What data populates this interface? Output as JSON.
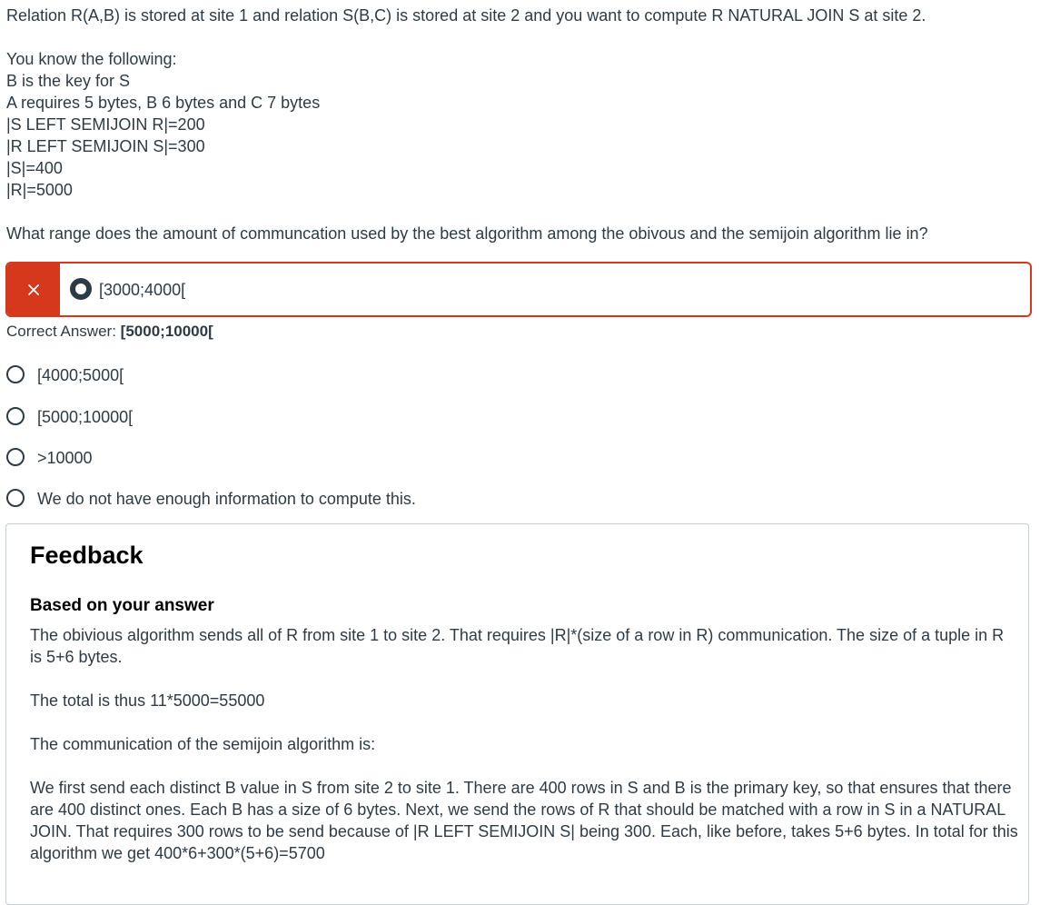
{
  "question": {
    "intro": "Relation R(A,B) is stored at site 1 and relation S(B,C) is stored at site 2 and you want to compute R NATURAL JOIN S at site 2.",
    "known_header": "You know the following:",
    "facts": [
      "B is the key for S",
      "A requires 5 bytes, B 6 bytes and C 7 bytes",
      "|S LEFT SEMIJOIN R|=200",
      "|R LEFT SEMIJOIN S|=300",
      "|S|=400",
      "|R|=5000"
    ],
    "prompt": "What range does the amount of communcation used by the best algorithm among the obivous and the semijoin algorithm lie in?"
  },
  "selected_answer": {
    "label": "[3000;4000[",
    "status": "incorrect",
    "marker_icon": "close-icon",
    "marker_color": "#d5381c"
  },
  "correct_answer": {
    "prefix": "Correct Answer:",
    "value": "[5000;10000["
  },
  "options": [
    {
      "label": "[4000;5000["
    },
    {
      "label": "[5000;10000["
    },
    {
      "label": ">10000"
    },
    {
      "label": "We do not have enough information to compute this."
    }
  ],
  "feedback": {
    "title": "Feedback",
    "subtitle": "Based on your answer",
    "paragraphs": [
      "The obivious algorithm sends all of R from site 1 to site 2. That requires |R|*(size of a row in R) communication. The size of a tuple in R is 5+6 bytes.",
      "The total is thus 11*5000=55000",
      "The communication of the semijoin algorithm is:",
      "We first send each distinct B value in S from site 2 to site 1. There are 400 rows in S and B is the primary key, so that ensures that there are 400 distinct ones. Each B has a size of 6 bytes. Next, we send the rows of R that should be matched with a row in S in a NATURAL JOIN. That requires 300 rows to be send because of |R LEFT SEMIJOIN S| being 300. Each, like before, takes 5+6 bytes. In total for this algorithm we get 400*6+300*(5+6)=5700"
    ]
  },
  "colors": {
    "text": "#2d3b45",
    "incorrect": "#d5381c",
    "border": "#c7cdd1"
  }
}
